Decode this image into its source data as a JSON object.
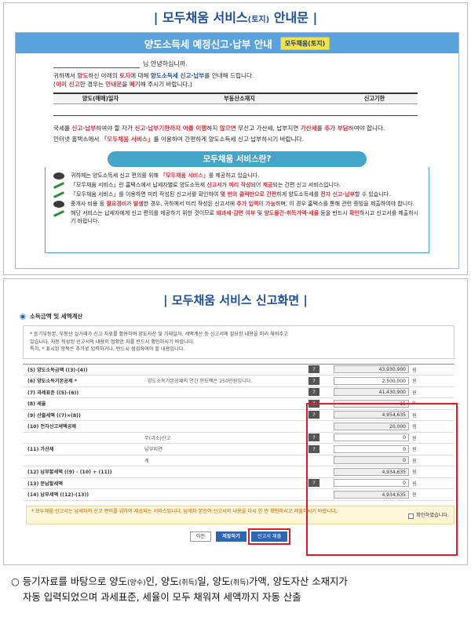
{
  "top_section": {
    "title_main": "모두채움 서비스",
    "title_small": "(토지)",
    "title_end": "안내문"
  },
  "notice_doc": {
    "header_title": "양도소득세 예정신고·납부 안내",
    "header_badge": "모두채움(토지)",
    "greeting": "님 안녕하십니까.",
    "intro_parts": [
      "귀하께서 ",
      "양도",
      "하신 아래의 ",
      "토지",
      "에 대해 ",
      "양도소득세 신고·납부",
      "를 안내해 드립니다."
    ],
    "intro2_parts": [
      "(",
      "이미 신고",
      "한 경우는 ",
      "안내문",
      "을 ",
      "폐기",
      "해 주시기 바랍니다.)"
    ],
    "table_headers": [
      "양도(매매)일자",
      "부동산소재지",
      "신고기한"
    ],
    "penalty_parts": [
      "국세를 ",
      "신고·납부",
      "하여야 할 자가 ",
      "신고·납부기한까지 이를 이행",
      "하지 ",
      "않으면",
      " 무신고 가산세, 납부지연 ",
      "가산세",
      "를 ",
      "추가 부담",
      "하여야 합니다."
    ],
    "hometax_parts": [
      "인터넷 홈택스에서 ",
      "「모두채움 서비스」",
      "를 이용하여 간편하게 양도소득세 신고·납부하시기 바랍니다."
    ]
  },
  "what_is": {
    "heading": "모두채움 서비스란?",
    "items": [
      [
        "귀하께는 양도소득세 신고 편의를 위해 ",
        "「모두채움 서비스」",
        "를 제공하고 있습니다."
      ],
      [
        "「모두채움 서비스」란 홈택스에서 납세자별로 양도소득세 ",
        "신고서",
        "가 ",
        "미리 작성",
        "되어 ",
        "제공",
        "되는 간편 신고 서비스입니다."
      ],
      [
        "「모두채움 서비스」를 이용하면 미리 작성된 신고서를 확인하여 ",
        "몇 번의 클릭만으로 간편",
        "하게 양도소득세를 ",
        "전자 신고·납부",
        "할 수 있습니다."
      ],
      [
        "중개사 비용 등 ",
        "필요경비",
        "가 ",
        "발생",
        "한 경우, 귀하께서 미리 작성된 신고서에 ",
        "추가 입력",
        "이 ",
        "가능",
        "하며, 이 경우 홈택스를 통해 관련 증빙을 제출하여야 합니다."
      ],
      [
        "해당 서비스는 납세자에게 신고 편의를 제공하기 위한 것이므로 ",
        "비과세·감면 여부",
        " 및 ",
        "양도물건·취득가액·세율",
        " 등을 반드시 ",
        "확인",
        "하시고 신고서를 제출하시기 바랍니다."
      ]
    ]
  },
  "bottom_section": {
    "title": "모두채움 서비스 신고화면"
  },
  "form": {
    "heading": "소득금액 및 세액계산",
    "notice_lines": [
      "* 등기부등본, 부동산 실거래가 신고 자료를 활용하여 양도자산 및 거래일자, 세액계산 등 신고서에 필요한 내용을 미리 채워주고",
      "있습니다. 자동 작성된 신고서의 내용이 정확한 지를 반드시 확인하시기 바랍니다.",
      "특히, * 표시된 항목은 추가로 입력하거나, 반드시 점검하여야 할 내용입니다."
    ],
    "rows": [
      {
        "label": "(5) 양도소득금액 ((3)-(4))",
        "sub": "",
        "q": "?",
        "value": "43,930,900",
        "unit": "원",
        "white": false
      },
      {
        "label": "(6) 양도소득기본공제 *",
        "sub": "· 양도소득기본공제의 연간 한도액은 250만원입니다.",
        "q": "?",
        "value": "2,500,000",
        "unit": "원",
        "white": true
      },
      {
        "label": "(7) 과세표준 ((5)-(6))",
        "sub": "",
        "q": "?",
        "value": "41,430,900",
        "unit": "원",
        "white": false
      },
      {
        "label": "(8) 세율",
        "sub": "",
        "q": "?",
        "value": "15",
        "unit": "%",
        "white": false
      },
      {
        "label": "(9) 산출세액 ((7)×(8))",
        "sub": "",
        "q": "?",
        "value": "4,954,635",
        "unit": "원",
        "white": false
      },
      {
        "label": "(10) 전자신고세액공제",
        "sub": "",
        "q": "",
        "value": "20,000",
        "unit": "원",
        "white": false
      },
      {
        "label": "",
        "sub": "무(과소)신고",
        "q": "?",
        "value": "0",
        "unit": "원",
        "white": true
      },
      {
        "label": "(11) 가산세",
        "sub": "납부지연",
        "q": "?",
        "value": "0",
        "unit": "원",
        "white": true
      },
      {
        "label": "",
        "sub": "계",
        "q": "",
        "value": "0",
        "unit": "원",
        "white": false
      },
      {
        "label": "(12) 납부할세액 ((9) - (10) + (11))",
        "sub": "",
        "q": "",
        "value": "4,934,635",
        "unit": "원",
        "white": false
      },
      {
        "label": "(13) 분납할세액",
        "sub": "",
        "q": "?",
        "value": "0",
        "unit": "원",
        "white": true
      },
      {
        "label": "(14) 납부세액 ((12)-(13))",
        "sub": "",
        "q": "",
        "value": "4,934,635",
        "unit": "원",
        "white": false
      }
    ],
    "bottom_note": "* 모두채움 신고서는 납세자의 신고 편의를 위하여 제공되는 서비스입니다. 납세자 본인이 신고서의 내용을 다시 한 번 확인하시고 제출하시기 바랍니다.",
    "confirm_label": "확인하였습니다.",
    "buttons": {
      "prev": "이전",
      "save": "저장하기",
      "submit": "신고서 제출"
    }
  },
  "caption": {
    "bullet": "○",
    "parts": [
      "등기자료를 바탕으로 양도",
      "(양수)",
      "인, 양도",
      "(취득)",
      "일, 양도",
      "(취득)",
      "가액, 양도자산 소재지가"
    ],
    "line2": "자동 입력되었으며 과세표준, 세율이 모두 채워져 세액까지 자동 산출"
  }
}
